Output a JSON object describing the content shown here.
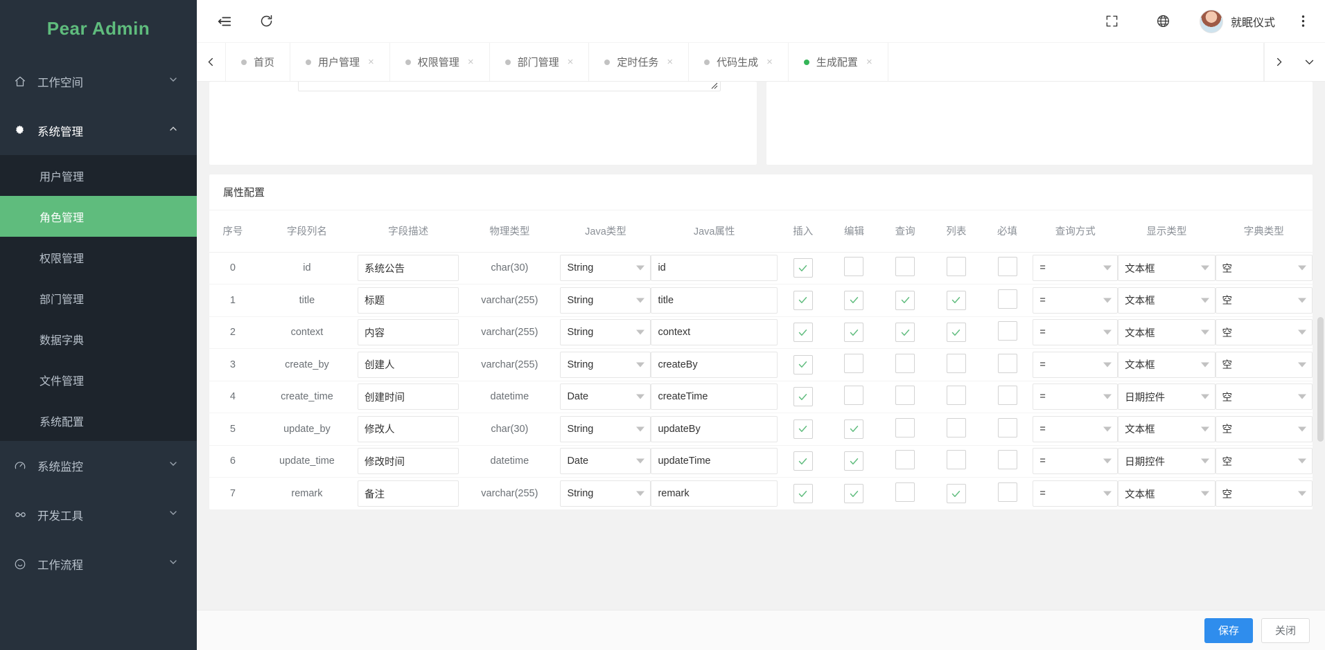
{
  "brand": {
    "title": "Pear Admin"
  },
  "sidebar": {
    "groups": [
      {
        "label": "工作空间",
        "icon": "home-icon",
        "open": false,
        "items": []
      },
      {
        "label": "系统管理",
        "icon": "gear-icon",
        "open": true,
        "items": [
          {
            "label": "用户管理",
            "active": false
          },
          {
            "label": "角色管理",
            "active": true
          },
          {
            "label": "权限管理",
            "active": false
          },
          {
            "label": "部门管理",
            "active": false
          },
          {
            "label": "数据字典",
            "active": false
          },
          {
            "label": "文件管理",
            "active": false
          },
          {
            "label": "系统配置",
            "active": false
          }
        ]
      },
      {
        "label": "系统监控",
        "icon": "gauge-icon",
        "open": false,
        "items": []
      },
      {
        "label": "开发工具",
        "icon": "tools-icon",
        "open": false,
        "items": []
      },
      {
        "label": "工作流程",
        "icon": "flow-icon",
        "open": false,
        "items": []
      }
    ]
  },
  "topbar": {
    "collapse_icon": "menu-collapse-icon",
    "refresh_icon": "refresh-icon",
    "fullscreen_icon": "fullscreen-icon",
    "language_icon": "globe-icon",
    "avatar_icon": "avatar",
    "user_name": "就眠仪式",
    "more_icon": "more-vertical-icon"
  },
  "tabbar": {
    "prev_icon": "chevron-left-icon",
    "next_icon": "chevron-right-icon",
    "more_icon": "chevron-down-icon",
    "tabs": [
      {
        "label": "首页",
        "active": false,
        "closable": false
      },
      {
        "label": "用户管理",
        "active": false,
        "closable": true
      },
      {
        "label": "权限管理",
        "active": false,
        "closable": true
      },
      {
        "label": "部门管理",
        "active": false,
        "closable": true
      },
      {
        "label": "定时任务",
        "active": false,
        "closable": true
      },
      {
        "label": "代码生成",
        "active": false,
        "closable": true
      },
      {
        "label": "生成配置",
        "active": true,
        "closable": true
      }
    ],
    "close_glyph": "×"
  },
  "card": {
    "title": "属性配置",
    "columns": [
      "序号",
      "字段列名",
      "字段描述",
      "物理类型",
      "Java类型",
      "Java属性",
      "插入",
      "编辑",
      "查询",
      "列表",
      "必填",
      "查询方式",
      "显示类型",
      "字典类型"
    ],
    "rows": [
      {
        "index": "0",
        "column": "id",
        "desc": "系统公告",
        "phys": "char(30)",
        "javaType": "String",
        "javaProp": "id",
        "insert": true,
        "edit": false,
        "query": false,
        "list": false,
        "required": false,
        "queryMode": "=",
        "showType": "文本框",
        "dictType": "空"
      },
      {
        "index": "1",
        "column": "title",
        "desc": "标题",
        "phys": "varchar(255)",
        "javaType": "String",
        "javaProp": "title",
        "insert": true,
        "edit": true,
        "query": true,
        "list": true,
        "required": false,
        "queryMode": "=",
        "showType": "文本框",
        "dictType": "空"
      },
      {
        "index": "2",
        "column": "context",
        "desc": "内容",
        "phys": "varchar(255)",
        "javaType": "String",
        "javaProp": "context",
        "insert": true,
        "edit": true,
        "query": true,
        "list": true,
        "required": false,
        "queryMode": "=",
        "showType": "文本框",
        "dictType": "空"
      },
      {
        "index": "3",
        "column": "create_by",
        "desc": "创建人",
        "phys": "varchar(255)",
        "javaType": "String",
        "javaProp": "createBy",
        "insert": true,
        "edit": false,
        "query": false,
        "list": false,
        "required": false,
        "queryMode": "=",
        "showType": "文本框",
        "dictType": "空"
      },
      {
        "index": "4",
        "column": "create_time",
        "desc": "创建时间",
        "phys": "datetime",
        "javaType": "Date",
        "javaProp": "createTime",
        "insert": true,
        "edit": false,
        "query": false,
        "list": false,
        "required": false,
        "queryMode": "=",
        "showType": "日期控件",
        "dictType": "空"
      },
      {
        "index": "5",
        "column": "update_by",
        "desc": "修改人",
        "phys": "char(30)",
        "javaType": "String",
        "javaProp": "updateBy",
        "insert": true,
        "edit": true,
        "query": false,
        "list": false,
        "required": false,
        "queryMode": "=",
        "showType": "文本框",
        "dictType": "空"
      },
      {
        "index": "6",
        "column": "update_time",
        "desc": "修改时间",
        "phys": "datetime",
        "javaType": "Date",
        "javaProp": "updateTime",
        "insert": true,
        "edit": true,
        "query": false,
        "list": false,
        "required": false,
        "queryMode": "=",
        "showType": "日期控件",
        "dictType": "空"
      },
      {
        "index": "7",
        "column": "remark",
        "desc": "备注",
        "phys": "varchar(255)",
        "javaType": "String",
        "javaProp": "remark",
        "insert": true,
        "edit": true,
        "query": false,
        "list": true,
        "required": false,
        "queryMode": "=",
        "showType": "文本框",
        "dictType": "空"
      }
    ]
  },
  "footer": {
    "save_label": "保存",
    "close_label": "关闭"
  },
  "colors": {
    "brand": "#5FBC7D",
    "sidebar": "#27313c",
    "submenu": "#1d242c",
    "primary": "#2f8ded",
    "check": "#5FBC7D"
  }
}
